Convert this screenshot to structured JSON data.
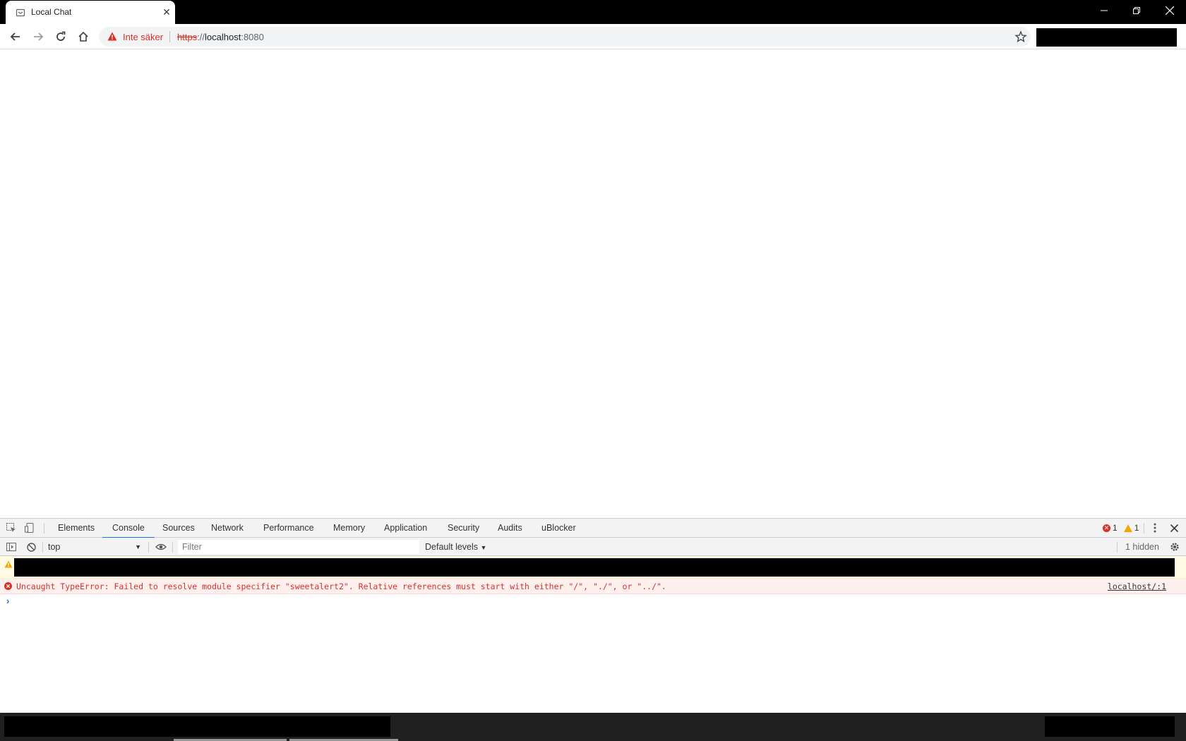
{
  "browser": {
    "tab": {
      "title": "Local Chat"
    },
    "security_label": "Inte säker",
    "url": {
      "scheme": "https",
      "rest": "://",
      "host": "localhost",
      "port": ":8080"
    }
  },
  "devtools": {
    "tabs": [
      "Elements",
      "Console",
      "Sources",
      "Network",
      "Performance",
      "Memory",
      "Application",
      "Security",
      "Audits",
      "uBlocker"
    ],
    "active_tab": "Console",
    "error_count": "1",
    "warning_count": "1",
    "context": "top",
    "filter_placeholder": "Filter",
    "levels": "Default levels",
    "hidden": "1 hidden",
    "error_message": "Uncaught TypeError: Failed to resolve module specifier \"sweetalert2\". Relative references must start with either \"/\", \"./\", or \"../\".",
    "error_source": "localhost/:1",
    "colors": {
      "error": "#d93025",
      "warning": "#f2a600",
      "accent": "#1a73e8"
    }
  }
}
